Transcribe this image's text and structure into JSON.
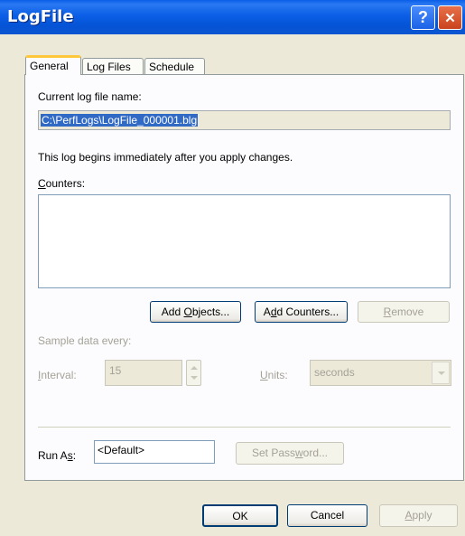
{
  "window": {
    "title": "LogFile",
    "help_glyph": "?",
    "close_glyph": "✕"
  },
  "tabs": [
    {
      "label": "General"
    },
    {
      "label": "Log Files"
    },
    {
      "label": "Schedule"
    }
  ],
  "general": {
    "current_log_label": "Current log file name:",
    "current_log_value": "C:\\PerfLogs\\LogFile_000001.blg",
    "begins_text": "This log begins immediately after you apply changes.",
    "counters_label": {
      "accel": "C",
      "rest": "ounters:"
    },
    "add_objects": {
      "before": "Add ",
      "accel": "O",
      "rest": "bjects..."
    },
    "add_counters": {
      "before": "A",
      "accel": "d",
      "rest": "d Counters..."
    },
    "remove": {
      "before": "",
      "accel": "R",
      "rest": "emove"
    },
    "sample_label": "Sample data every:",
    "interval_label": {
      "accel": "I",
      "rest": "nterval:"
    },
    "interval_value": "15",
    "units_label": {
      "accel": "U",
      "rest": "nits:"
    },
    "units_value": "seconds",
    "run_as_label": {
      "before": "Run A",
      "accel": "s",
      "rest": ":"
    },
    "run_as_value": "<Default>",
    "set_password": {
      "before": "Set Pass",
      "accel": "w",
      "rest": "ord..."
    }
  },
  "footer": {
    "ok": "OK",
    "cancel": "Cancel",
    "apply": {
      "accel": "A",
      "rest": "pply"
    }
  },
  "colors": {
    "title_bar": "#0553d6",
    "dialog_bg": "#ece9d8",
    "selection": "#316ac5",
    "disabled_text": "#a4a297"
  }
}
